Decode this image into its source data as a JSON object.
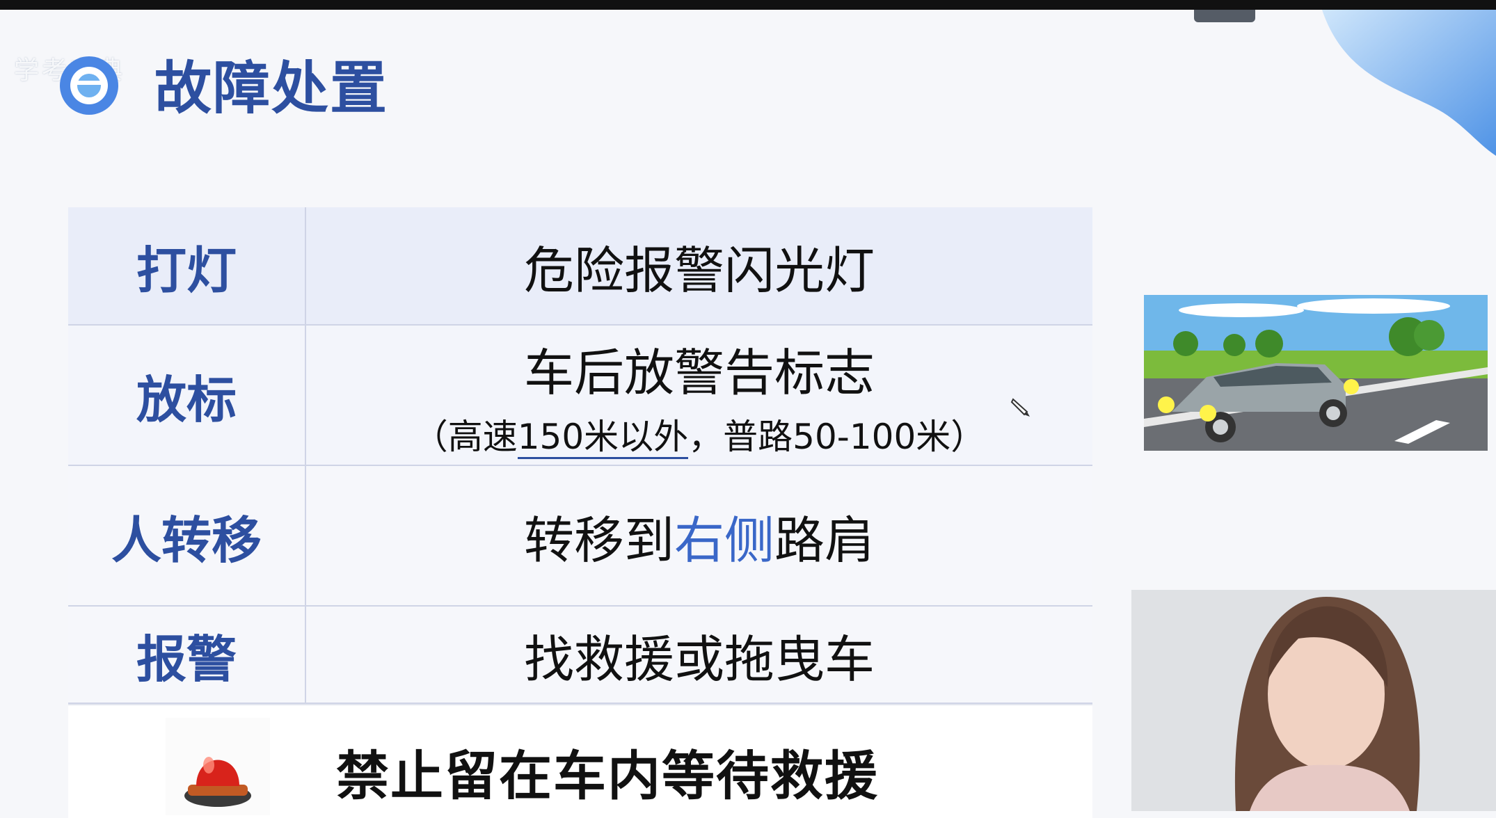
{
  "header": {
    "title": "故障处置",
    "watermark": "学考宝典"
  },
  "table": {
    "rows": [
      {
        "label": "打灯",
        "content": "危险报警闪光灯"
      },
      {
        "label": "放标",
        "content": "车后放警告标志",
        "sub_open": "（高速",
        "sub_underlined": "150米以外",
        "sub_rest": "，普路50-100米）"
      },
      {
        "label": "人转移",
        "content_pre": "转移到",
        "content_highlight": "右侧",
        "content_post": "路肩"
      },
      {
        "label": "报警",
        "content": "找救援或拖曳车"
      }
    ],
    "warning": "禁止留在车内等待救援"
  },
  "icons": {
    "title_icon": "circle-logo-icon",
    "alarm_icon": "red-alarm-light-icon",
    "pencil_icon": "pencil-cursor-icon"
  },
  "colors": {
    "accent": "#2d4fa0",
    "highlight": "#3a67c8",
    "header_row": "#e9edf9"
  }
}
